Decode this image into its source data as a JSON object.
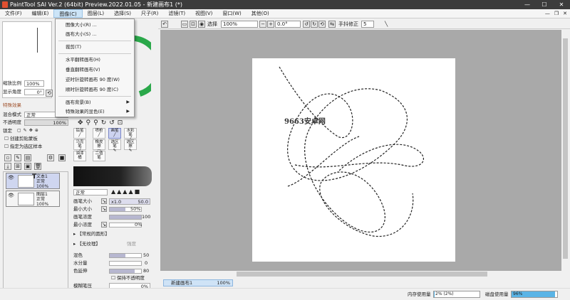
{
  "app": {
    "title": "PaintTool SAI Ver.2 (64bit) Preview.2022.01.05 - 新建画布1 (*)",
    "window_buttons": [
      "—",
      "☐",
      "✕"
    ]
  },
  "menubar": {
    "items": [
      "文件(F)",
      "编辑(E)",
      "图像(C)",
      "图层(L)",
      "选择(S)",
      "尺子(R)",
      "滤镜(T)",
      "视图(V)",
      "窗口(W)",
      "其他(O)"
    ],
    "active_index": 2,
    "mdi_buttons": [
      "—",
      "❐",
      "✕"
    ]
  },
  "image_menu": {
    "items": [
      {
        "label": "图像大小(R) ..."
      },
      {
        "label": "画布大小(S) ..."
      },
      {
        "label": "裁剪(T)"
      },
      {
        "label": "水平翻转画布(H)"
      },
      {
        "label": "垂直翻转画布(V)"
      },
      {
        "label": "逆时针旋转画布 90 度(W)"
      },
      {
        "label": "顺时针旋转画布 90 度(C)"
      },
      {
        "label": "画布背景(B)",
        "submenu": true
      },
      {
        "label": "特殊效果的显色(E)",
        "submenu": true
      }
    ]
  },
  "toolbar": {
    "select_label": "选择",
    "zoom": "100%",
    "angle": "0.0°",
    "stabilizer_label": "手抖修正",
    "stabilizer_value": "5"
  },
  "navigator": {
    "zoom_label": "缩放比例",
    "zoom_value": "100%",
    "angle_label": "显示角度",
    "angle_value": "0°"
  },
  "effects": {
    "header": "特殊效果",
    "blend_label": "混合模式",
    "blend_value": "正常",
    "opacity_label": "不透明度",
    "opacity_value": "100%"
  },
  "layer_options": {
    "lock_label": "锁定",
    "clip_label": "创建剪贴蒙板",
    "selection_source_label": "指定为选区样本"
  },
  "layers": [
    {
      "name": "文本1",
      "mode": "正常",
      "opacity": "100%",
      "icon": "T"
    },
    {
      "name": "图层1",
      "mode": "正常",
      "opacity": "100%",
      "icon": ""
    }
  ],
  "tools": {
    "row1": [
      "铅笔",
      "喷枪",
      "画笔",
      "水彩笔"
    ],
    "row2": [
      "马克笔",
      "橡皮擦",
      "选区笔",
      "选区擦"
    ],
    "row3": [
      "油漆桶",
      "二值笔"
    ]
  },
  "brush": {
    "blend_value": "正常",
    "size_label": "画笔大小",
    "size_mult": "x1.0",
    "size_value": "50.0",
    "min_size_label": "最小大小",
    "min_size_value": "50%",
    "min_size_fraction": 0.5,
    "density_label": "画笔浓度",
    "density_value": "100",
    "density_fraction": 1.0,
    "min_density_label": "最小浓度",
    "min_density_value": "0%",
    "shape_label": "【常规的圆形】",
    "texture_label": "【无纹理】",
    "texture_strength": "强度",
    "mix_label": "混色",
    "mix_value": "50",
    "water_label": "水分量",
    "water_value": "0",
    "persistence_label": "色延伸",
    "persistence_value": "80",
    "keep_opacity_label": "保持不透明度",
    "blur_label": "模糊笔压",
    "blur_value": "0%"
  },
  "canvas": {
    "watermark": "9663安卓网"
  },
  "documents": [
    {
      "name": "新建画布1",
      "zoom": "100%"
    }
  ],
  "status": {
    "memory_label": "内存使用量",
    "memory_value": "2% (2%)",
    "memory_fraction": 0.02,
    "disk_label": "磁盘使用量",
    "disk_value": "96%",
    "disk_fraction": 0.96
  },
  "colors": {
    "menu_highlight": "#cce4f7",
    "selected_tool": "#cdd3f0",
    "accent_green": "#2aa84a"
  }
}
